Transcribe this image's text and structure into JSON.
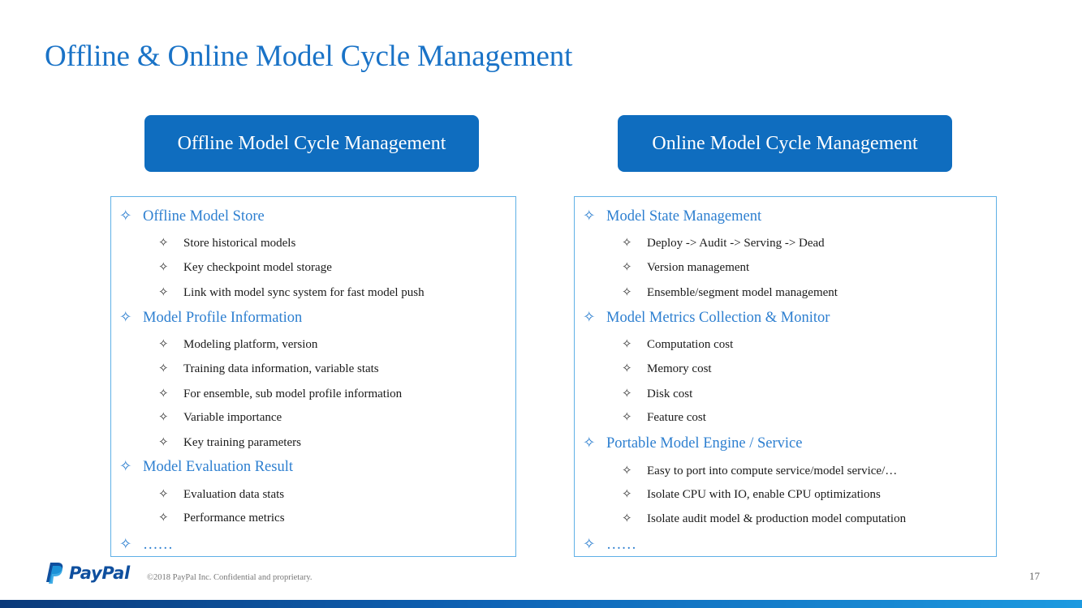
{
  "slide": {
    "title": "Offline & Online Model Cycle Management",
    "page_number": "17",
    "copyright": "©2018 PayPal Inc. Confidential and proprietary.",
    "logo_text": "PayPal",
    "bullet_icon": "four-point-star-outline",
    "colors": {
      "title": "#1a73c7",
      "header_fill": "#0f6dbf",
      "box_border": "#5fb0e6",
      "level1_text": "#2d7fd0"
    }
  },
  "offline": {
    "header": "Offline Model Cycle Management",
    "items": [
      {
        "level": 1,
        "text": "Offline Model Store"
      },
      {
        "level": 2,
        "text": "Store historical models"
      },
      {
        "level": 2,
        "text": "Key checkpoint model storage"
      },
      {
        "level": 2,
        "text": "Link with model sync system for fast model push"
      },
      {
        "level": 1,
        "text": "Model Profile Information"
      },
      {
        "level": 2,
        "text": "Modeling platform, version"
      },
      {
        "level": 2,
        "text": "Training data information, variable stats"
      },
      {
        "level": 2,
        "text": "For ensemble, sub model profile information"
      },
      {
        "level": 2,
        "text": "Variable importance"
      },
      {
        "level": 2,
        "text": "Key training parameters"
      },
      {
        "level": 1,
        "text": "Model Evaluation Result"
      },
      {
        "level": 2,
        "text": "Evaluation data stats"
      },
      {
        "level": 2,
        "text": "Performance metrics"
      },
      {
        "level": 1,
        "text": "……"
      }
    ]
  },
  "online": {
    "header": "Online Model Cycle Management",
    "items": [
      {
        "level": 1,
        "text": "Model State Management"
      },
      {
        "level": 2,
        "text": "Deploy -> Audit -> Serving -> Dead"
      },
      {
        "level": 2,
        "text": "Version management"
      },
      {
        "level": 2,
        "text": "Ensemble/segment model management"
      },
      {
        "level": 1,
        "text": "Model Metrics Collection & Monitor"
      },
      {
        "level": 2,
        "text": "Computation cost"
      },
      {
        "level": 2,
        "text": "Memory cost"
      },
      {
        "level": 2,
        "text": "Disk cost"
      },
      {
        "level": 2,
        "text": "Feature cost"
      },
      {
        "level": 1,
        "text": "Portable Model Engine /  Service"
      },
      {
        "level": 2,
        "text": "Easy to port into compute service/model service/…"
      },
      {
        "level": 2,
        "text": "Isolate CPU with IO, enable CPU optimizations"
      },
      {
        "level": 2,
        "text": "Isolate audit model & production model computation"
      },
      {
        "level": 1,
        "text": "……"
      }
    ]
  }
}
